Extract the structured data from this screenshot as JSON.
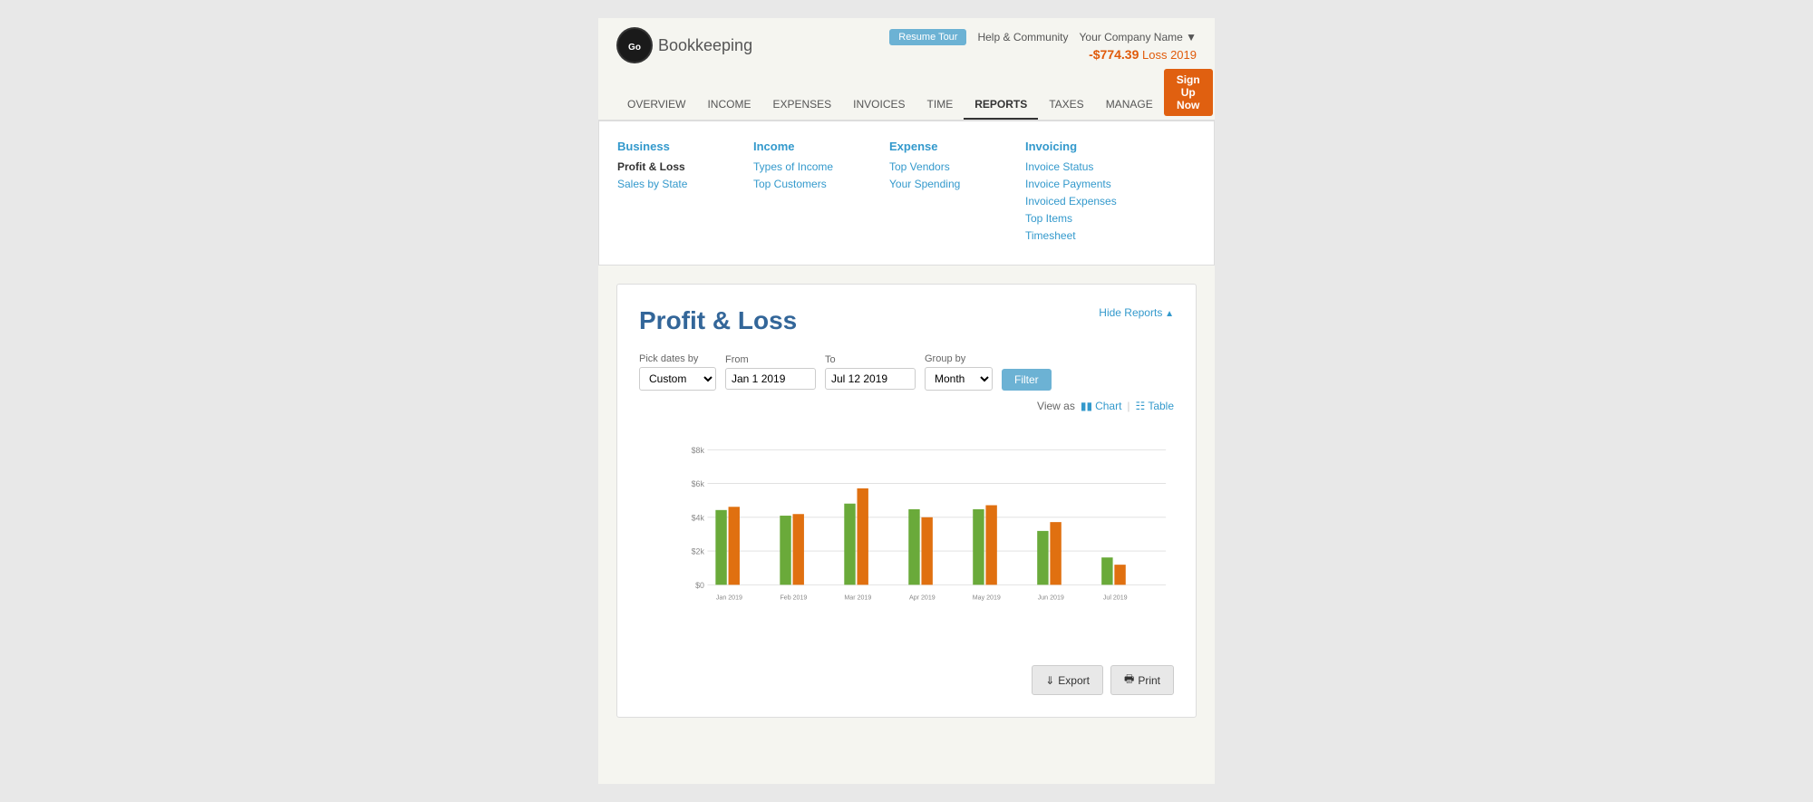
{
  "header": {
    "app_name": "Bookkeeping",
    "resume_tour_label": "Resume Tour",
    "help_link": "Help & Community",
    "company_name": "Your Company Name",
    "loss_amount": "-$774.39",
    "loss_label": "Loss 2019",
    "signup_label": "Sign Up Now"
  },
  "nav": {
    "items": [
      {
        "label": "OVERVIEW",
        "active": false
      },
      {
        "label": "INCOME",
        "active": false
      },
      {
        "label": "EXPENSES",
        "active": false
      },
      {
        "label": "INVOICES",
        "active": false
      },
      {
        "label": "TIME",
        "active": false
      },
      {
        "label": "REPORTS",
        "active": true
      },
      {
        "label": "TAXES",
        "active": false
      },
      {
        "label": "MANAGE",
        "active": false
      }
    ]
  },
  "dropdown": {
    "columns": [
      {
        "title": "Business",
        "items": [
          {
            "label": "Profit & Loss",
            "bold": true
          },
          {
            "label": "Sales by State",
            "bold": false
          }
        ]
      },
      {
        "title": "Income",
        "items": [
          {
            "label": "Types of Income",
            "bold": false
          },
          {
            "label": "Top Customers",
            "bold": false
          }
        ]
      },
      {
        "title": "Expense",
        "items": [
          {
            "label": "Top Vendors",
            "bold": false
          },
          {
            "label": "Your Spending",
            "bold": false
          }
        ]
      },
      {
        "title": "Invoicing",
        "items": [
          {
            "label": "Invoice Status",
            "bold": false
          },
          {
            "label": "Invoice Payments",
            "bold": false
          },
          {
            "label": "Invoiced Expenses",
            "bold": false
          },
          {
            "label": "Top Items",
            "bold": false
          },
          {
            "label": "Timesheet",
            "bold": false
          }
        ]
      }
    ]
  },
  "report": {
    "title": "Profit & Loss",
    "hide_reports_label": "Hide Reports",
    "filter": {
      "dates_label": "Pick dates by",
      "dates_option": "Custom",
      "from_label": "From",
      "from_value": "Jan 1 2019",
      "to_label": "To",
      "to_value": "Jul 12 2019",
      "group_by_label": "Group by",
      "group_by_option": "Month",
      "filter_btn_label": "Filter"
    },
    "view_as": {
      "label": "View as",
      "chart_label": "Chart",
      "table_label": "Table"
    },
    "chart": {
      "y_labels": [
        "$8k",
        "$6k",
        "$4k",
        "$2k",
        "$0"
      ],
      "months": [
        "Jan 2019",
        "Feb 2019",
        "Mar 2019",
        "Apr 2019",
        "May 2019",
        "Jun 2019",
        "Jul 2019"
      ],
      "income": [
        4400,
        4100,
        4800,
        4500,
        4500,
        3200,
        1600
      ],
      "expenses": [
        4600,
        4200,
        5700,
        4000,
        4700,
        3700,
        1200
      ],
      "income_color": "#6aaa3a",
      "expense_color": "#e07010"
    },
    "export_label": "Export",
    "print_label": "Print"
  }
}
